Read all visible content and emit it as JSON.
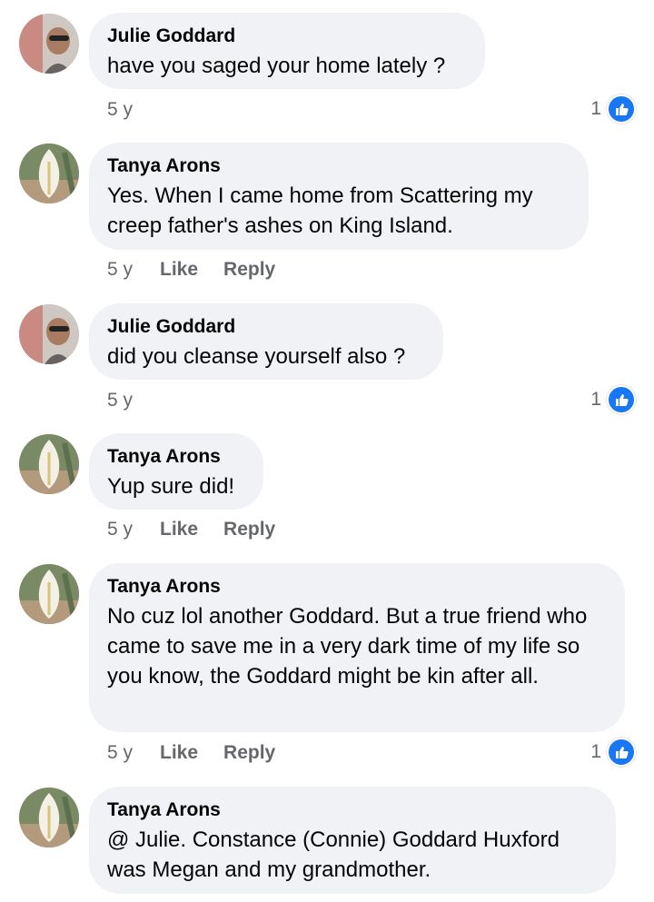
{
  "comments": [
    {
      "author": "Julie Goddard",
      "avatar": "julie-avatar",
      "text": "have you saged your home lately ?",
      "time": "5 y",
      "reactions": "1",
      "like_label": "",
      "reply_label": ""
    },
    {
      "author": "Tanya Arons",
      "avatar": "tanya-avatar",
      "text": "Yes.  When I came home from Scattering my creep father's ashes on King Island.",
      "time": "5 y",
      "like_label": "Like",
      "reply_label": "Reply"
    },
    {
      "author": "Julie Goddard",
      "avatar": "julie-avatar",
      "text": "did you cleanse yourself also ?",
      "time": "5 y",
      "reactions": "1"
    },
    {
      "author": "Tanya Arons",
      "avatar": "tanya-avatar",
      "text": "Yup sure did!",
      "time": "5 y",
      "like_label": "Like",
      "reply_label": "Reply"
    },
    {
      "author": "Tanya Arons",
      "avatar": "tanya-avatar",
      "text": "No cuz lol another Goddard.  But a true friend who came to save me in a very dark time of my life so you know, the Goddard might be kin after all.",
      "time": "5 y",
      "like_label": "Like",
      "reply_label": "Reply",
      "reactions": "1"
    },
    {
      "author": "Tanya Arons",
      "avatar": "tanya-avatar",
      "text": "@ Julie.  Constance (Connie) Goddard Huxford was Megan and my grandmother."
    }
  ],
  "colors": {
    "bubble": "#f0f2f5",
    "meta": "#65676b",
    "like_blue": "#1877f2"
  }
}
